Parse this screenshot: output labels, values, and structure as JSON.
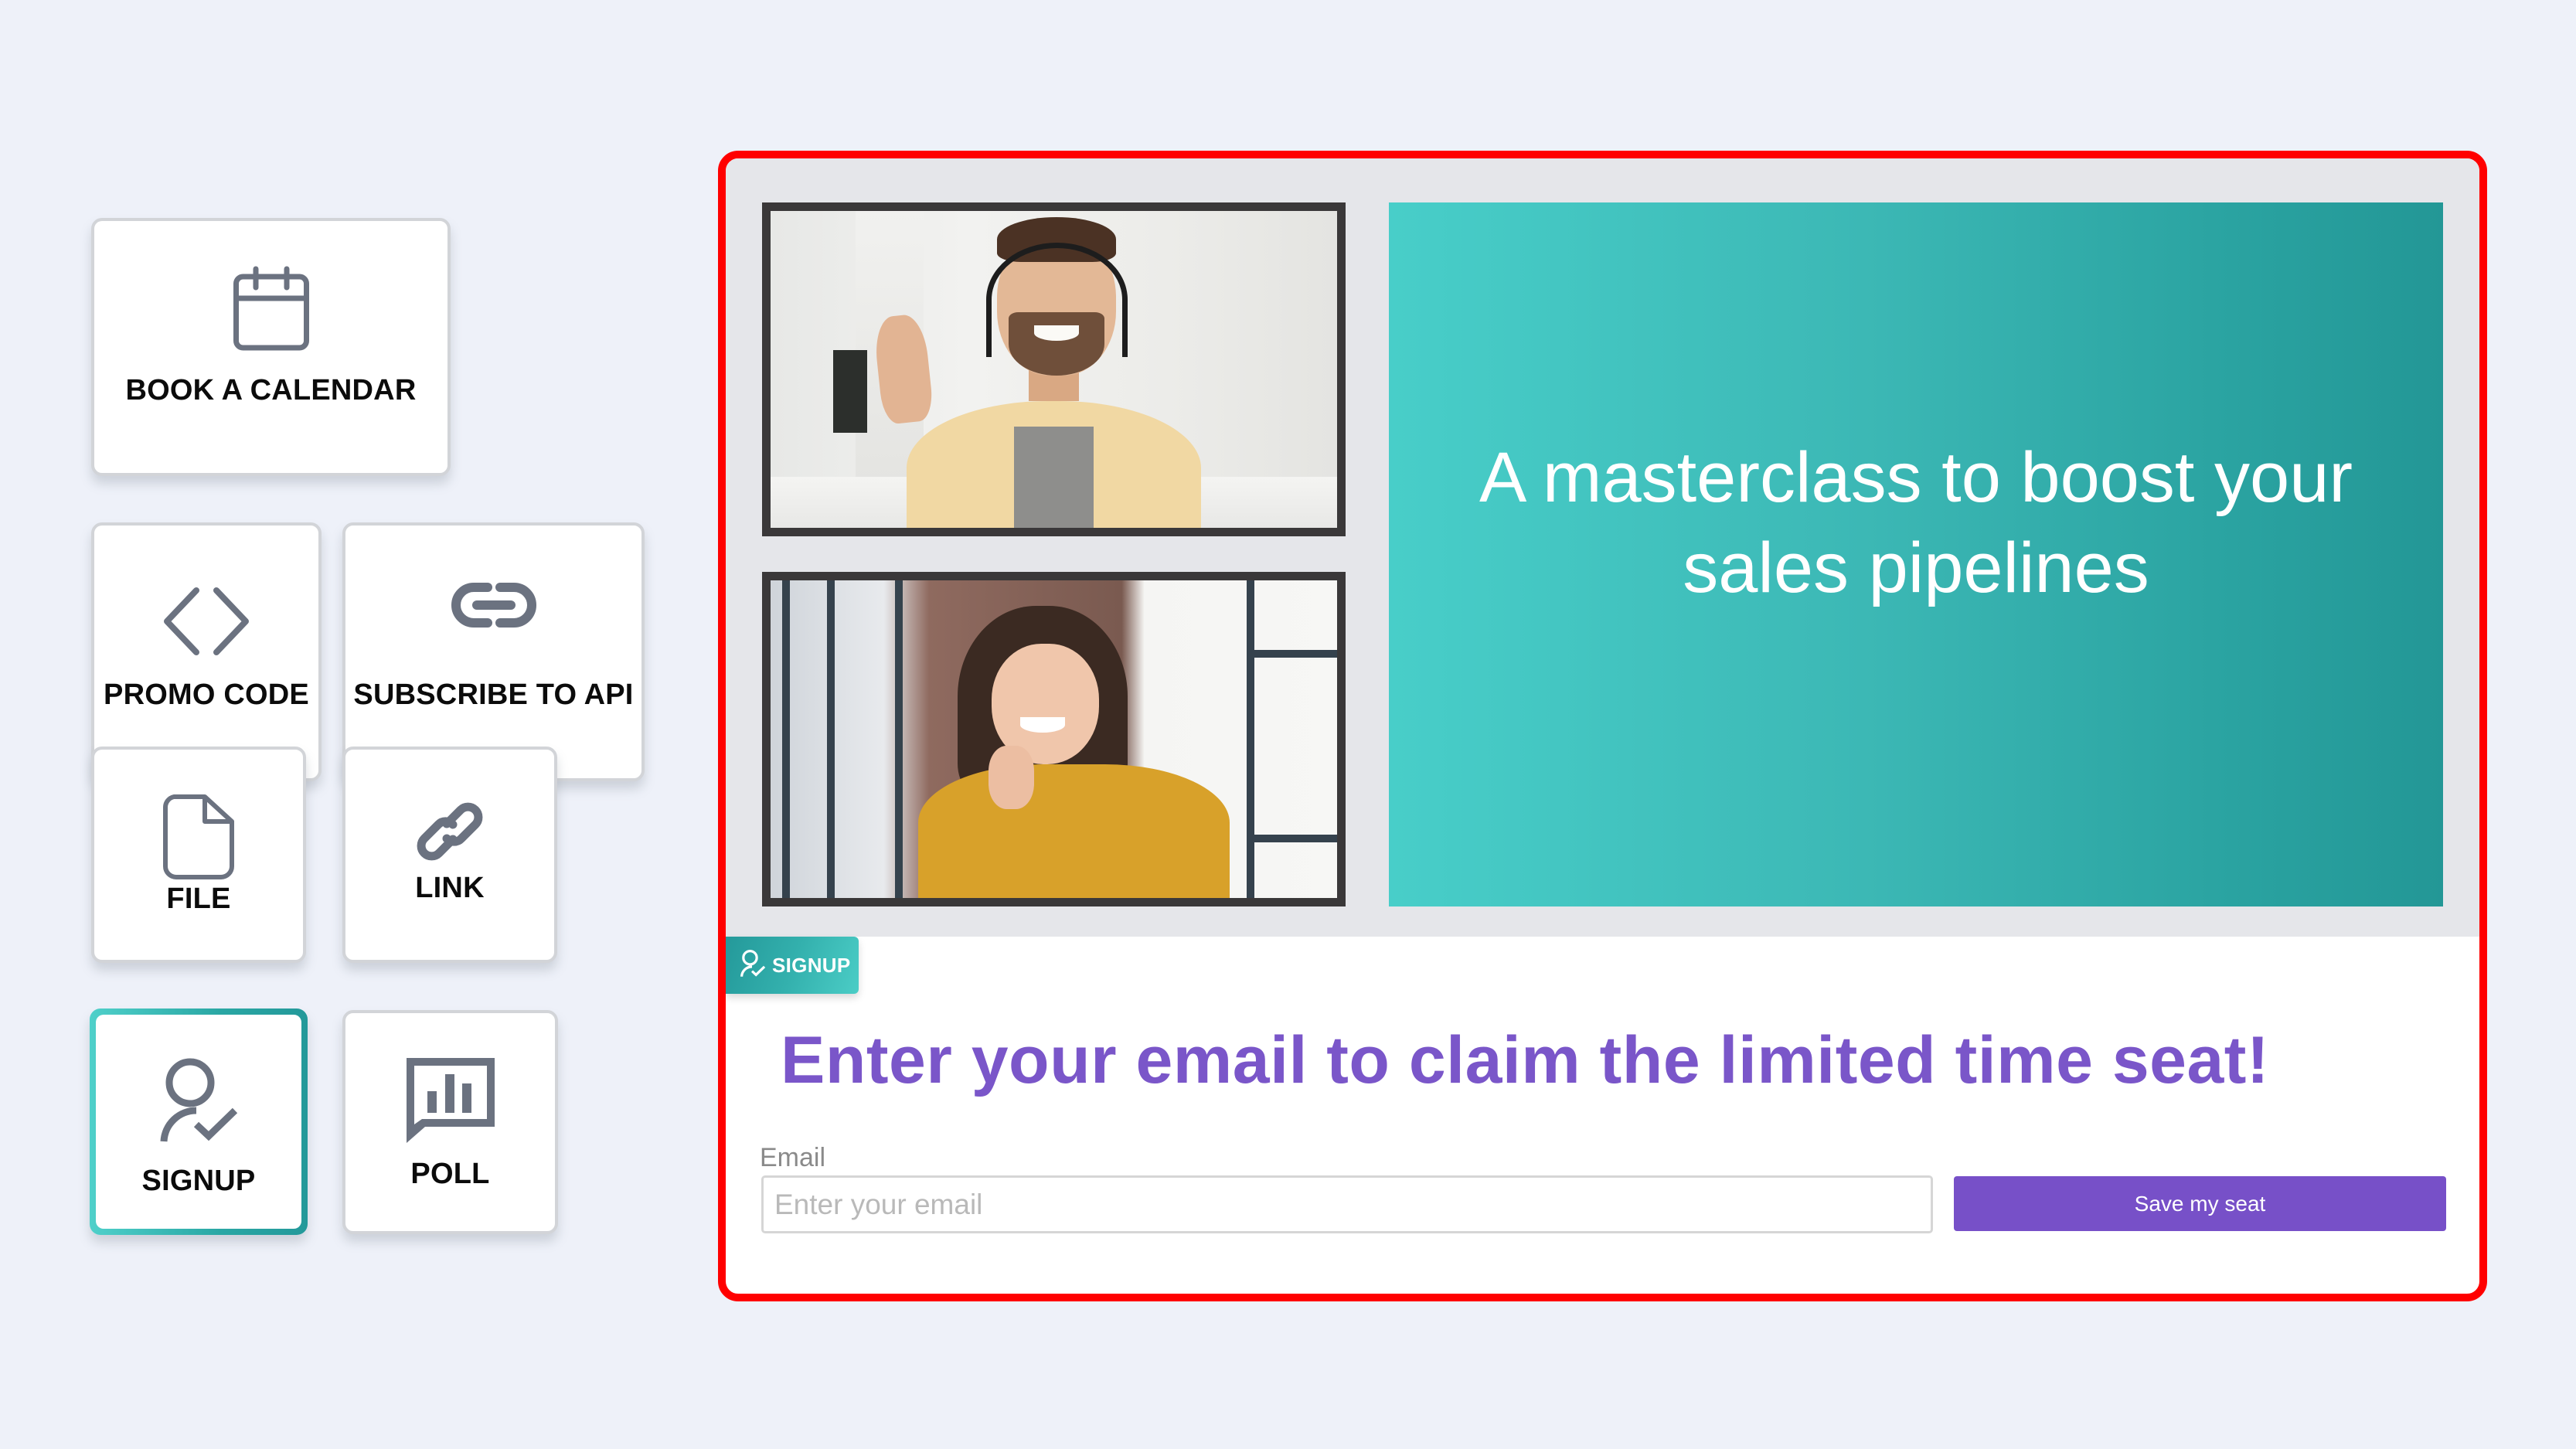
{
  "widgets": [
    {
      "id": "calendar",
      "label": "BOOK A CALENDAR",
      "icon": "calendar-icon",
      "selected": false
    },
    {
      "id": "promo",
      "label": "PROMO CODE",
      "icon": "code-icon",
      "selected": false
    },
    {
      "id": "api",
      "label": "SUBSCRIBE TO API",
      "icon": "api-link-icon",
      "selected": false
    },
    {
      "id": "file",
      "label": "FILE",
      "icon": "file-icon",
      "selected": false
    },
    {
      "id": "link",
      "label": "LINK",
      "icon": "link-icon",
      "selected": false
    },
    {
      "id": "signup",
      "label": "SIGNUP",
      "icon": "user-check-icon",
      "selected": true
    },
    {
      "id": "poll",
      "label": "POLL",
      "icon": "poll-chart-icon",
      "selected": false
    }
  ],
  "preview": {
    "videos": [
      {
        "description": "Smiling man with headset waving"
      },
      {
        "description": "Smiling woman in yellow sweater"
      }
    ],
    "hero_title": "A masterclass to boost your sales pipelines",
    "badge": {
      "label": "SIGNUP",
      "icon": "user-check-icon"
    },
    "form": {
      "heading": "Enter your email to claim the limited time seat!",
      "email_label": "Email",
      "email_value": "",
      "email_placeholder": "Enter your email",
      "submit_label": "Save my seat"
    }
  },
  "colors": {
    "background": "#eef1f9",
    "highlight_border": "#ff0000",
    "teal_start": "#48cec9",
    "teal_end": "#239796",
    "purple": "#7750c8",
    "icon_gray": "#6b7280"
  }
}
